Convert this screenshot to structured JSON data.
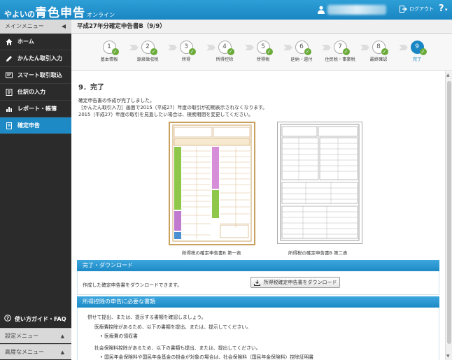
{
  "header": {
    "logo_prefix": "やよいの",
    "logo_main": "青色申告",
    "logo_suffix": "オンライン",
    "logout_label": "ログアウト",
    "help_label": "?"
  },
  "sidebar": {
    "main_menu_label": "メインメニュー",
    "items": [
      {
        "label": "ホーム"
      },
      {
        "label": "かんたん取引入力"
      },
      {
        "label": "スマート取引取込"
      },
      {
        "label": "仕訳の入力"
      },
      {
        "label": "レポート・帳簿"
      },
      {
        "label": "確定申告"
      }
    ],
    "faq_label": "使い方ガイド・FAQ",
    "settings_menu_label": "設定メニュー",
    "advanced_menu_label": "高度なメニュー"
  },
  "page": {
    "title": "平成27年分確定申告書B（9/9）"
  },
  "steps": [
    {
      "num": "1",
      "label": "基本情報"
    },
    {
      "num": "2",
      "label": "源泉徴収税"
    },
    {
      "num": "3",
      "label": "所得"
    },
    {
      "num": "4",
      "label": "所得控除"
    },
    {
      "num": "5",
      "label": "所得税"
    },
    {
      "num": "6",
      "label": "延納・還付"
    },
    {
      "num": "7",
      "label": "住民税・事業税"
    },
    {
      "num": "8",
      "label": "最終確認"
    },
    {
      "num": "9",
      "label": "完了"
    }
  ],
  "content": {
    "section_title": "9．完了",
    "messages": [
      "確定申告書の作成が完了しました。",
      "［かんたん取引入力］画面で2015（平成27）年度の取引が初期表示されなくなります。",
      "2015（平成27）年度の取引を見直したい場合は、検索期間を変更してください。"
    ],
    "doc1_caption": "所得税の確定申告書B 第一表",
    "doc2_caption": "所得税の確定申告書B 第二表",
    "download_panel_title": "完了・ダウンロード",
    "download_text": "作成した確定申告書をダウンロードできます。",
    "download_button": "所得税確定申告書をダウンロード",
    "docs_panel_title": "所得控除の申告に必要な書類",
    "docs_intro": "併せて提出、または、提示する書類を確認しましょう。",
    "docs_medical": "医療費控除があるため、以下の書類を提出、または、提示してください。",
    "docs_medical_item": "医療費の領収書",
    "docs_social": "社会保険料控除があるため、以下の書類も提出、または、提出してください。",
    "docs_social_item": "国民年金保険料や国民年金基金の掛金が対象の場合は、社会保険料（国民年金保険料）控除証明書"
  }
}
